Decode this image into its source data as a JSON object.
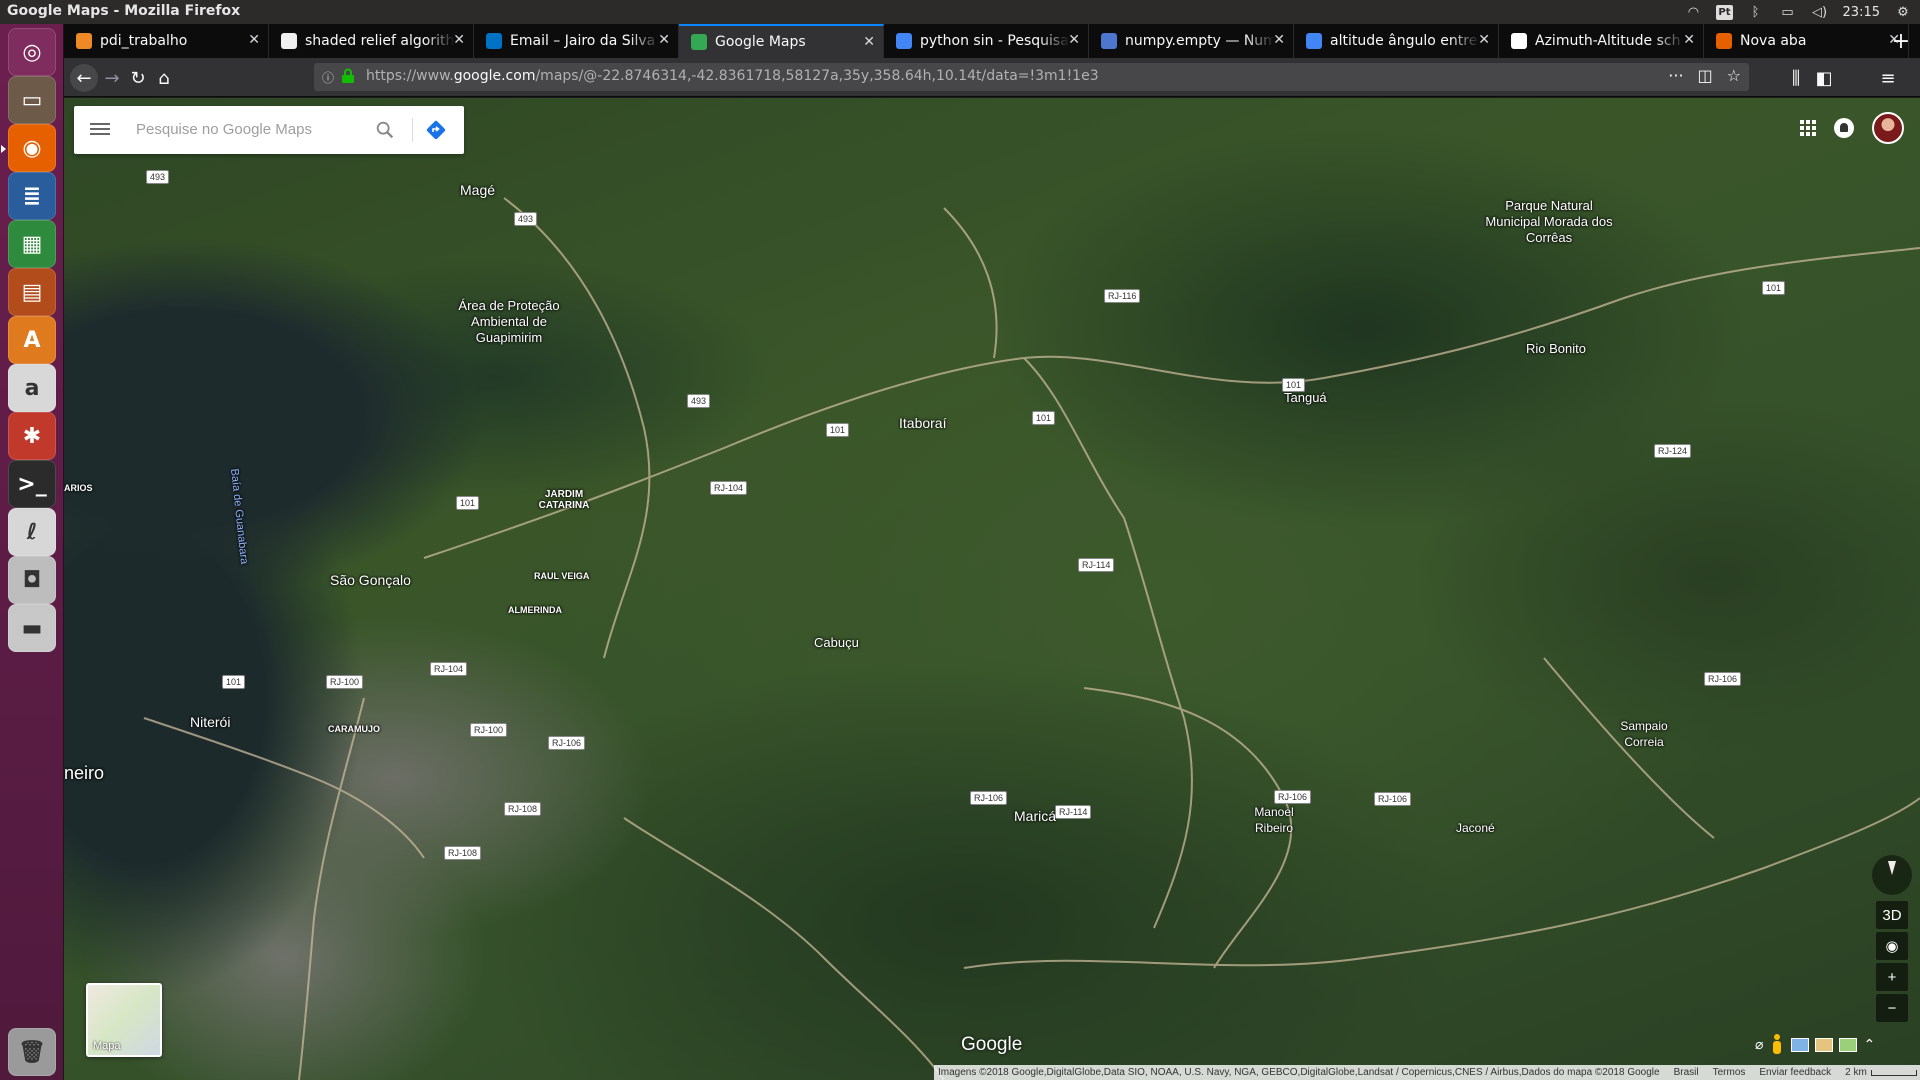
{
  "window": {
    "title": "Google Maps - Mozilla Firefox"
  },
  "tray": {
    "keyboard": "Pt",
    "clock": "23:15"
  },
  "launcher": [
    {
      "name": "ubuntu-dash-icon",
      "color": "#7f2c5f",
      "glyph": "◎"
    },
    {
      "name": "files-icon",
      "color": "#6e5a48",
      "glyph": "▭"
    },
    {
      "name": "firefox-icon",
      "color": "#e66000",
      "glyph": "◉"
    },
    {
      "name": "writer-icon",
      "color": "#2a5d9c",
      "glyph": "≣"
    },
    {
      "name": "calc-icon",
      "color": "#2e8b3d",
      "glyph": "▦"
    },
    {
      "name": "impress-icon",
      "color": "#b24c1a",
      "glyph": "▤"
    },
    {
      "name": "software-center-icon",
      "color": "#e07a1e",
      "glyph": "A"
    },
    {
      "name": "amazon-icon",
      "color": "#d8d8d8",
      "glyph": "a"
    },
    {
      "name": "settings-icon",
      "color": "#c0392b",
      "glyph": "✱"
    },
    {
      "name": "terminal-icon",
      "color": "#2b2b2b",
      "glyph": ">_"
    },
    {
      "name": "draw-icon",
      "color": "#d7d7d7",
      "glyph": "ℓ"
    },
    {
      "name": "camera-icon",
      "color": "#bdbdbd",
      "glyph": "◘"
    },
    {
      "name": "drive-icon",
      "color": "#c8c8c8",
      "glyph": "▬"
    },
    {
      "name": "trash-icon",
      "color": "#9a9a9a",
      "glyph": "🗑"
    }
  ],
  "tabs": [
    {
      "label": "pdi_trabalho",
      "icon": "folder",
      "icon_color": "#ee8a26",
      "active": false
    },
    {
      "label": "shaded relief algorithm",
      "icon": "github",
      "icon_color": "#f0f0f0",
      "active": false
    },
    {
      "label": "Email – Jairo da Silva",
      "icon": "outlook",
      "icon_color": "#0072c6",
      "active": false
    },
    {
      "label": "Google Maps",
      "icon": "maps",
      "icon_color": "#34a853",
      "active": true
    },
    {
      "label": "python sin - Pesquisa Google",
      "icon": "google",
      "icon_color": "#4285f4",
      "active": false
    },
    {
      "label": "numpy.empty — NumPy",
      "icon": "numpy",
      "icon_color": "#4d77cf",
      "active": false
    },
    {
      "label": "altitude ângulo entre",
      "icon": "google",
      "icon_color": "#4285f4",
      "active": false
    },
    {
      "label": "Azimuth-Altitude sch",
      "icon": "wikipedia",
      "icon_color": "#ffffff",
      "active": false
    },
    {
      "label": "Nova aba",
      "icon": "firefox",
      "icon_color": "#e66000",
      "active": false
    }
  ],
  "urlbar": {
    "scheme": "https://www.",
    "host": "google.com",
    "path": "/maps/@-22.8746314,-42.8361718,58127a,35y,358.64h,10.14t/data=!3m1!1e3"
  },
  "search": {
    "placeholder": "Pesquise no Google Maps"
  },
  "map_labels": {
    "mage": "Magé",
    "apa": "Área de Proteção Ambiental de Guapimirim",
    "parque": "Parque Natural Municipal Morada dos Corrêas",
    "rio_bonito": "Rio Bonito",
    "itaborai": "Itaboraí",
    "tangua": "Tanguá",
    "baia": "Baía de Guanabara",
    "arios": "ARIOS",
    "jardim": "JARDIM CATARINA",
    "sao_goncalo": "São Gonçalo",
    "raul_veiga": "RAUL VEIGA",
    "almerinda": "ALMERINDA",
    "cabucu": "Cabuçu",
    "niteroi": "Niterói",
    "caramujo": "CARAMUJO",
    "neiro": "neiro",
    "marica": "Maricá",
    "manoel": "Manoel Ribeiro",
    "sampaio": "Sampaio Correia",
    "jacone": "Jaconé"
  },
  "road_shields": {
    "r493a": "493",
    "r493b": "493",
    "r493c": "493",
    "rj116": "RJ-116",
    "r101a": "101",
    "r101b": "101",
    "r101c": "101",
    "r101d": "101",
    "r101e": "101",
    "r101f": "101",
    "rj124": "RJ-124",
    "rj104a": "RJ-104",
    "rj104b": "RJ-104",
    "rj114a": "RJ-114",
    "rj114b": "RJ-114",
    "rj100a": "RJ-100",
    "rj100b": "RJ-100",
    "rj106a": "RJ-106",
    "rj106b": "RJ-106",
    "rj106c": "RJ-106",
    "rj106d": "RJ-106",
    "rj106e": "RJ-106",
    "rj108a": "RJ-108",
    "rj108b": "RJ-108"
  },
  "minimap": {
    "label": "Mapa"
  },
  "controls": {
    "three_d": "3D",
    "zoom_in": "+",
    "zoom_out": "−",
    "expand": "⌃"
  },
  "google_logo": "Google",
  "attribution": {
    "imagery": "Imagens ©2018 Google,DigitalGlobe,Data SIO, NOAA, U.S. Navy, NGA, GEBCO,DigitalGlobe,Landsat / Copernicus,CNES / Airbus,Dados do mapa ©2018 Google",
    "country": "Brasil",
    "terms": "Termos",
    "feedback": "Enviar feedback",
    "scale": "2 km"
  }
}
